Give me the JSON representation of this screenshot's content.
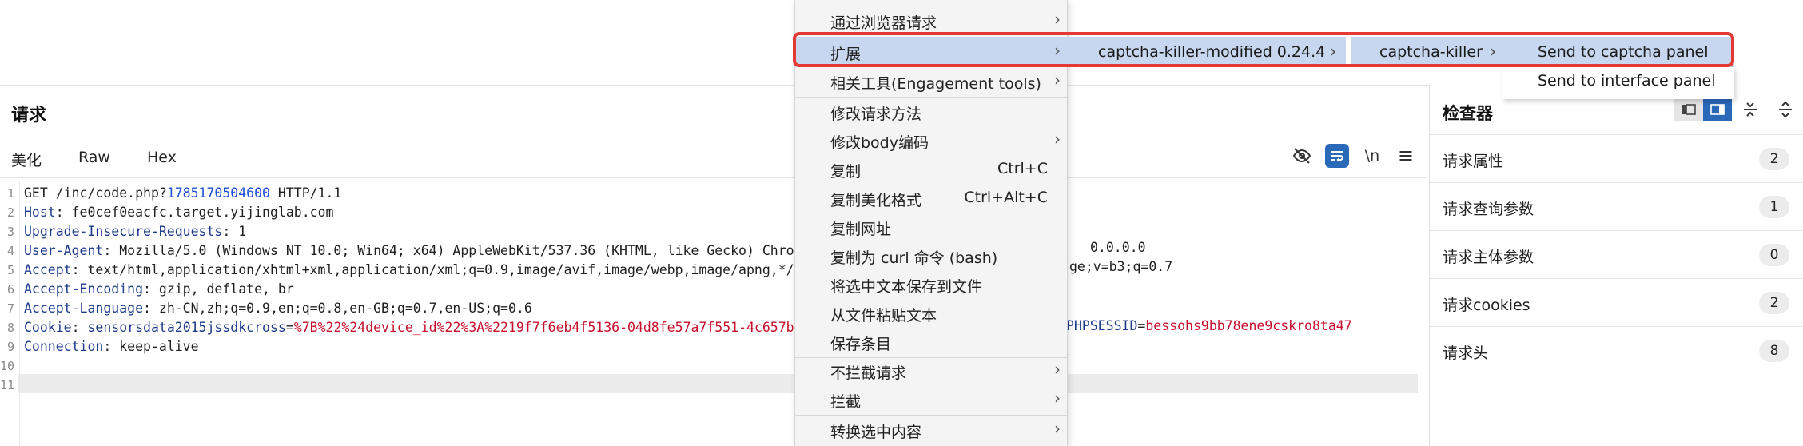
{
  "request": {
    "title": "请求",
    "tabs": [
      "美化",
      "Raw",
      "Hex"
    ],
    "toolbar": {
      "newline_label": "\\n"
    },
    "lines": [
      {
        "n": "1",
        "parts": [
          [
            "hv",
            "GET /inc/code.php?"
          ],
          [
            "num",
            "1785170504600"
          ],
          [
            "hv",
            " HTTP/1.1"
          ]
        ]
      },
      {
        "n": "2",
        "parts": [
          [
            "hk",
            "Host"
          ],
          [
            "hv",
            ": fe0cef0eacfc.target.yijinglab.com"
          ]
        ]
      },
      {
        "n": "3",
        "parts": [
          [
            "hk",
            "Upgrade-Insecure-Requests"
          ],
          [
            "hv",
            ": 1"
          ]
        ]
      },
      {
        "n": "4",
        "parts": [
          [
            "hk",
            "User-Agent"
          ],
          [
            "hv",
            ": Mozilla/5.0 (Windows NT 10.0; Win64; x64) AppleWebKit/537.36 (KHTML, like Gecko) Chro"
          ]
        ]
      },
      {
        "n": "5",
        "parts": [
          [
            "hk",
            "Accept"
          ],
          [
            "hv",
            ": text/html,application/xhtml+xml,application/xml;q=0.9,image/avif,image/webp,image/apng,*/"
          ]
        ]
      },
      {
        "n": "6",
        "parts": [
          [
            "hk",
            "Accept-Encoding"
          ],
          [
            "hv",
            ": gzip, deflate, br"
          ]
        ]
      },
      {
        "n": "7",
        "parts": [
          [
            "hk",
            "Accept-Language"
          ],
          [
            "hv",
            ": zh-CN,zh;q=0.9,en;q=0.8,en-GB;q=0.7,en-US;q=0.6"
          ]
        ]
      },
      {
        "n": "8",
        "parts": [
          [
            "hk",
            "Cookie"
          ],
          [
            "hv",
            ": "
          ],
          [
            "ck",
            "sensorsdata2015jssdkcross"
          ],
          [
            "hv",
            "="
          ],
          [
            "cv",
            "%7B%22%24device_id%22%3A%2219f7f6eb4f5136-04d8fe57a7f551-4c657b"
          ]
        ]
      },
      {
        "n": "9",
        "parts": [
          [
            "hk",
            "Connection"
          ],
          [
            "hv",
            ": keep-alive"
          ]
        ]
      },
      {
        "n": "10",
        "parts": []
      },
      {
        "n": "11",
        "parts": []
      }
    ],
    "overflow_right": {
      "line4": "0.0.0.0",
      "line5": "ge;v=b3;q=0.7",
      "line8_key": "PHPSESSID",
      "line8_eq": "=",
      "line8_val": "bessohs9bb78ene9cskro8ta47"
    }
  },
  "inspector": {
    "title": "检查器",
    "rows": [
      {
        "label": "请求属性",
        "count": "2"
      },
      {
        "label": "请求查询参数",
        "count": "1"
      },
      {
        "label": "请求主体参数",
        "count": "0"
      },
      {
        "label": "请求cookies",
        "count": "2"
      },
      {
        "label": "请求头",
        "count": "8"
      }
    ]
  },
  "context_menu": {
    "items": [
      {
        "label": "通过浏览器请求",
        "submenu": true
      },
      {
        "label": "扩展",
        "submenu": true,
        "highlight": true
      },
      {
        "label": "相关工具(Engagement tools)",
        "submenu": true
      },
      {
        "label": "修改请求方法"
      },
      {
        "label": "修改body编码",
        "submenu": true
      },
      {
        "label": "复制",
        "shortcut": "Ctrl+C"
      },
      {
        "label": "复制美化格式",
        "shortcut": "Ctrl+Alt+C"
      },
      {
        "label": "复制网址"
      },
      {
        "label": "复制为 curl 命令 (bash)"
      },
      {
        "label": "将选中文本保存到文件"
      },
      {
        "label": "从文件粘贴文本"
      },
      {
        "label": "保存条目"
      },
      {
        "label": "不拦截请求",
        "submenu": true
      },
      {
        "label": "拦截",
        "submenu": true
      },
      {
        "label": "转换选中内容",
        "submenu": true
      }
    ],
    "arrow": "›"
  },
  "submenus": {
    "extension_name": "captcha-killer-modified 0.24.4",
    "plugin_name": "captcha-killer",
    "actions": [
      "Send to captcha panel",
      "Send to interface panel"
    ]
  },
  "colors": {
    "accent": "#2a68b8",
    "highlight": "#c7d7ef",
    "annotation_red": "#e53935",
    "tab_underline": "#e8762b"
  }
}
